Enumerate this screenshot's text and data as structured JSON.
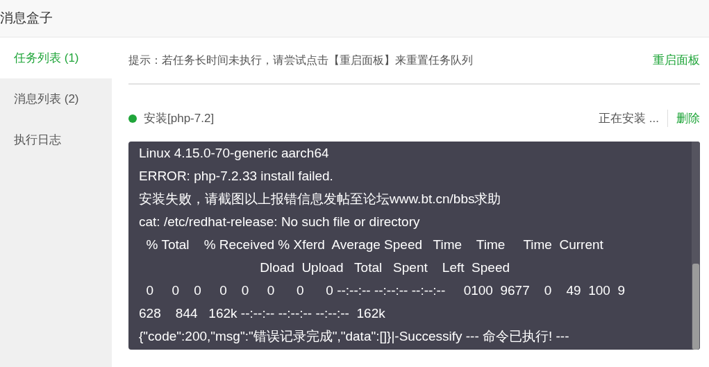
{
  "window": {
    "title": "消息盒子"
  },
  "sidebar": {
    "items": [
      {
        "label": "任务列表 (1)",
        "selected": true
      },
      {
        "label": "消息列表 (2)",
        "selected": false
      },
      {
        "label": "执行日志",
        "selected": false
      }
    ]
  },
  "tip": {
    "text": "提示：若任务长时间未执行，请尝试点击【重启面板】来重置任务队列",
    "action": "重启面板"
  },
  "task": {
    "name": "安装[php-7.2]",
    "status": "正在安装 ...",
    "delete": "删除",
    "color": "#20a53a"
  },
  "log": {
    "lines": [
      "Linux 4.15.0-70-generic aarch64",
      "ERROR: php-7.2.33 install failed.",
      "安装失败，请截图以上报错信息发帖至论坛www.bt.cn/bbs求助",
      "cat: /etc/redhat-release: No such file or directory",
      "  % Total    % Received % Xferd  Average Speed   Time    Time     Time  Current",
      "                                 Dload  Upload   Total   Spent    Left  Speed",
      "  0     0    0     0    0     0      0      0 --:--:-- --:--:-- --:--:--     0100  9677    0    49  100  9",
      "628    844   162k --:--:-- --:--:-- --:--:--  162k",
      "{\"code\":200,\"msg\":\"错误记录完成\",\"data\":[]}|-Successify --- 命令已执行! ---"
    ]
  }
}
